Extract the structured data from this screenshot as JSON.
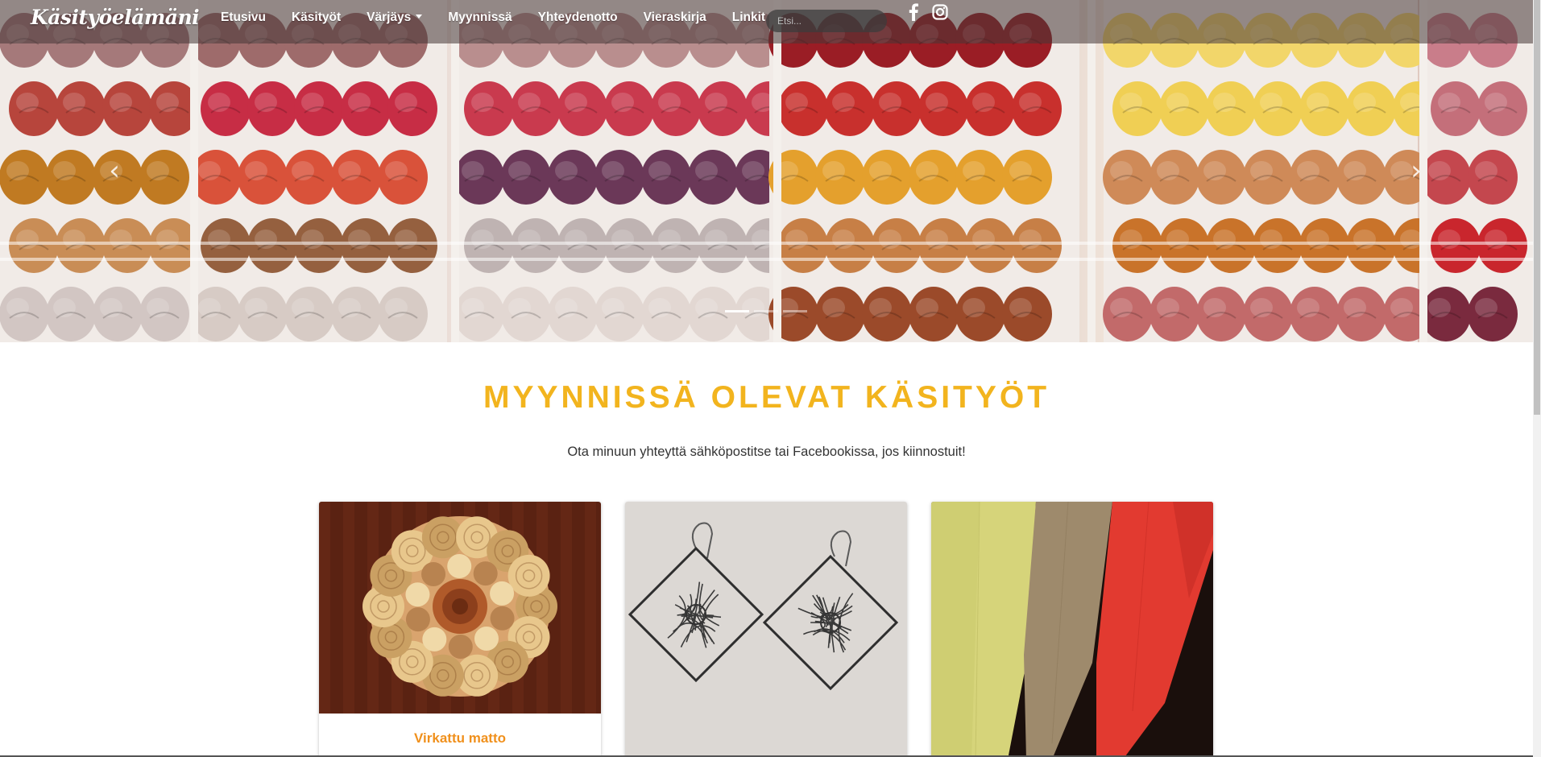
{
  "brand": "Käsityöelämäni",
  "nav": {
    "items": [
      {
        "label": "Etusivu"
      },
      {
        "label": "Käsityöt"
      },
      {
        "label": "Värjäys",
        "dropdown": true
      },
      {
        "label": "Myynnissä"
      },
      {
        "label": "Yhteydenotto"
      },
      {
        "label": "Vieraskirja"
      },
      {
        "label": "Linkit"
      }
    ],
    "search_placeholder": "Etsi...",
    "social": [
      "facebook-icon",
      "instagram-icon"
    ]
  },
  "carousel": {
    "prev_icon": "chevron-left-icon",
    "next_icon": "chevron-right-icon",
    "slides": 3,
    "active_slide": 1
  },
  "main": {
    "title": "MYYNNISSÄ OLEVAT KÄSITYÖT",
    "subtitle": "Ota minuun yhteyttä sähköpostitse tai Facebookissa, jos kiinnostuit!",
    "cards": [
      {
        "title": "Virkattu matto"
      },
      {
        "title": ""
      },
      {
        "title": ""
      }
    ]
  },
  "colors": {
    "accent": "#f2b41e",
    "card_title": "#f0901c",
    "navbar": "#463737"
  }
}
